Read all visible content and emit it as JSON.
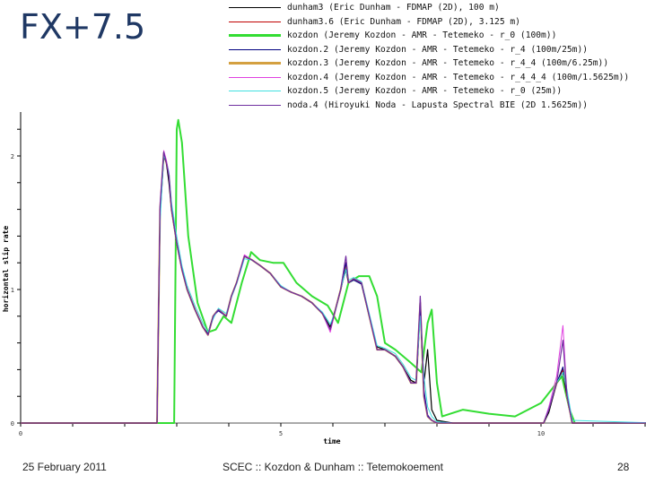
{
  "slide": {
    "title": "FX+7.5",
    "footer_date": "25 February 2011",
    "footer_center": "SCEC :: Kozdon & Dunham :: Tetemokoement",
    "page_number": "28"
  },
  "chart_data": {
    "type": "line",
    "title": "",
    "xlabel": "time",
    "ylabel": "horizontal slip rate",
    "xlim": [
      0,
      12.2
    ],
    "ylim": [
      0,
      2.33
    ],
    "x_ticks": [
      0,
      1,
      2,
      3,
      4,
      5,
      6,
      7,
      8,
      9,
      10,
      11,
      12
    ],
    "x_tick_labels": [
      {
        "value": 0,
        "label": "0"
      },
      {
        "value": 5,
        "label": "5"
      },
      {
        "value": 10,
        "label": "10"
      }
    ],
    "y_ticks": [
      0,
      0.2,
      0.4,
      0.6,
      0.8,
      1,
      1.2,
      1.4,
      1.6,
      1.8,
      2,
      2.2
    ],
    "y_tick_labels": [
      {
        "value": 0,
        "label": "0"
      },
      {
        "value": 1,
        "label": "1"
      },
      {
        "value": 2,
        "label": "2"
      }
    ],
    "grid": false,
    "legend_position": "top",
    "common_x": [
      0,
      2.62,
      2.68,
      2.75,
      2.8,
      2.85,
      2.9,
      3.0,
      3.1,
      3.2,
      3.35,
      3.5,
      3.6,
      3.7,
      3.8,
      3.95,
      4.05,
      4.15,
      4.3,
      4.45,
      4.6,
      4.8,
      5.0,
      5.2,
      5.4,
      5.6,
      5.8,
      5.95,
      6.05,
      6.15,
      6.25,
      6.3,
      6.4,
      6.55,
      6.7,
      6.85,
      7.0,
      7.2,
      7.35,
      7.5,
      7.6,
      7.68,
      7.75,
      7.82,
      7.9,
      8.0,
      8.3,
      10.05,
      10.15,
      10.3,
      10.42,
      10.5,
      10.6,
      12.2
    ],
    "series": [
      {
        "name": "dunham3 (Eric Dunham - FDMAP (2D), 100 m)",
        "color": "#000000",
        "width": 1.2,
        "y": [
          0,
          0,
          1.55,
          2.0,
          1.95,
          1.8,
          1.6,
          1.35,
          1.15,
          1.0,
          0.85,
          0.72,
          0.67,
          0.8,
          0.85,
          0.8,
          0.95,
          1.05,
          1.25,
          1.22,
          1.18,
          1.12,
          1.02,
          0.98,
          0.95,
          0.9,
          0.82,
          0.72,
          0.85,
          1.0,
          1.15,
          1.05,
          1.08,
          1.05,
          0.8,
          0.57,
          0.55,
          0.5,
          0.42,
          0.32,
          0.3,
          0.85,
          0.3,
          0.55,
          0.1,
          0.02,
          0,
          0,
          0.08,
          0.3,
          0.38,
          0.2,
          0,
          0
        ]
      },
      {
        "name": "dunham3.6 (Eric Dunham - FDMAP (2D), 3.125 m)",
        "color": "#c00000",
        "width": 1,
        "y": [
          0,
          0,
          1.6,
          2.02,
          1.95,
          1.85,
          1.6,
          1.35,
          1.15,
          1.0,
          0.85,
          0.72,
          0.66,
          0.8,
          0.85,
          0.8,
          0.95,
          1.05,
          1.25,
          1.22,
          1.18,
          1.12,
          1.02,
          0.98,
          0.95,
          0.9,
          0.82,
          0.7,
          0.85,
          1.0,
          1.2,
          1.05,
          1.08,
          1.05,
          0.8,
          0.55,
          0.55,
          0.5,
          0.42,
          0.3,
          0.3,
          0.9,
          0.2,
          0.05,
          0.02,
          0,
          0,
          0,
          0.1,
          0.3,
          0.4,
          0.2,
          0,
          0
        ]
      },
      {
        "name": "kozdon (Jeremy Kozdon - AMR - Tetemeko - r_0 (100m))",
        "color": "#33dd33",
        "width": 2,
        "x": [
          0,
          2.95,
          3.0,
          3.03,
          3.1,
          3.22,
          3.4,
          3.6,
          3.75,
          3.9,
          4.05,
          4.25,
          4.43,
          4.6,
          4.85,
          5.05,
          5.3,
          5.6,
          5.9,
          6.1,
          6.3,
          6.5,
          6.7,
          6.85,
          7.0,
          7.2,
          7.5,
          7.7,
          7.82,
          7.9,
          8.0,
          8.1,
          8.5,
          9.0,
          9.5,
          10.0,
          10.4,
          10.55,
          10.65,
          12.2
        ],
        "y": [
          0,
          0,
          2.2,
          2.27,
          2.1,
          1.4,
          0.9,
          0.68,
          0.7,
          0.8,
          0.75,
          1.05,
          1.28,
          1.22,
          1.2,
          1.2,
          1.05,
          0.95,
          0.88,
          0.75,
          1.05,
          1.1,
          1.1,
          0.95,
          0.6,
          0.55,
          0.45,
          0.38,
          0.75,
          0.85,
          0.3,
          0.05,
          0.1,
          0.07,
          0.05,
          0.15,
          0.35,
          0.1,
          0,
          0
        ]
      },
      {
        "name": "kozdon.2 (Jeremy Kozdon - AMR - Tetemeko - r_4 (100m/25m))",
        "color": "#000080",
        "width": 1,
        "y": [
          0,
          0,
          1.62,
          2.03,
          1.96,
          1.84,
          1.6,
          1.34,
          1.15,
          1.0,
          0.85,
          0.72,
          0.66,
          0.8,
          0.84,
          0.8,
          0.95,
          1.05,
          1.25,
          1.22,
          1.18,
          1.12,
          1.02,
          0.98,
          0.95,
          0.9,
          0.82,
          0.7,
          0.85,
          1.0,
          1.2,
          1.05,
          1.07,
          1.04,
          0.8,
          0.55,
          0.55,
          0.5,
          0.42,
          0.3,
          0.3,
          0.85,
          0.25,
          0.06,
          0.02,
          0,
          0,
          0,
          0.1,
          0.3,
          0.42,
          0.2,
          0,
          0
        ]
      },
      {
        "name": "kozdon.3 (Jeremy Kozdon - AMR - Tetemeko - r_4_4 (100m/6.25m))",
        "color": "#d4a040",
        "width": 2,
        "y": [
          0,
          0,
          1.6,
          2.02,
          1.95,
          1.85,
          1.6,
          1.35,
          1.15,
          1.0,
          0.85,
          0.72,
          0.66,
          0.8,
          0.85,
          0.8,
          0.95,
          1.05,
          1.25,
          1.22,
          1.18,
          1.12,
          1.02,
          0.98,
          0.95,
          0.9,
          0.82,
          0.7,
          0.85,
          1.0,
          1.2,
          1.05,
          1.08,
          1.05,
          0.8,
          0.55,
          0.55,
          0.5,
          0.42,
          0.3,
          0.3,
          0.9,
          0.2,
          0.05,
          0.02,
          0,
          0,
          0,
          0.1,
          0.3,
          0.4,
          0.2,
          0,
          0
        ]
      },
      {
        "name": "kozdon.4 (Jeremy Kozdon - AMR - Tetemeko - r_4_4_4 (100m/1.5625m))",
        "color": "#e040e0",
        "width": 1,
        "y": [
          0,
          0,
          1.65,
          2.04,
          1.97,
          1.86,
          1.6,
          1.35,
          1.15,
          1.0,
          0.85,
          0.72,
          0.66,
          0.8,
          0.85,
          0.8,
          0.95,
          1.05,
          1.26,
          1.22,
          1.18,
          1.12,
          1.02,
          0.98,
          0.95,
          0.9,
          0.82,
          0.68,
          0.85,
          1.0,
          1.25,
          1.05,
          1.08,
          1.05,
          0.8,
          0.55,
          0.55,
          0.5,
          0.42,
          0.3,
          0.3,
          0.95,
          0.2,
          0.05,
          0.02,
          0,
          0,
          0,
          0.12,
          0.35,
          0.73,
          0.2,
          0,
          0
        ]
      },
      {
        "name": "kozdon.5 (Jeremy Kozdon - AMR - Tetemeko - r_0 (25m))",
        "color": "#40e0e0",
        "width": 1,
        "y": [
          0,
          0,
          1.5,
          2.0,
          1.96,
          1.88,
          1.65,
          1.4,
          1.18,
          1.03,
          0.88,
          0.75,
          0.68,
          0.78,
          0.86,
          0.82,
          0.94,
          1.04,
          1.23,
          1.22,
          1.18,
          1.12,
          1.03,
          0.98,
          0.95,
          0.9,
          0.83,
          0.74,
          0.84,
          1.0,
          1.15,
          1.07,
          1.09,
          1.06,
          0.82,
          0.58,
          0.56,
          0.52,
          0.44,
          0.34,
          0.32,
          0.8,
          0.35,
          0.12,
          0.05,
          0.01,
          0,
          0,
          0.12,
          0.3,
          0.38,
          0.25,
          0.02,
          0
        ]
      },
      {
        "name": "noda.4 (Hiroyuki Noda - Lapusta Spectral BIE (2D 1.5625m))",
        "color": "#7030a0",
        "width": 1.2,
        "y": [
          0,
          0,
          1.62,
          2.03,
          1.95,
          1.85,
          1.6,
          1.35,
          1.15,
          1.0,
          0.85,
          0.72,
          0.66,
          0.8,
          0.85,
          0.8,
          0.95,
          1.05,
          1.25,
          1.22,
          1.18,
          1.12,
          1.02,
          0.98,
          0.95,
          0.9,
          0.82,
          0.7,
          0.85,
          1.0,
          1.25,
          1.05,
          1.08,
          1.05,
          0.8,
          0.55,
          0.55,
          0.5,
          0.42,
          0.3,
          0.3,
          0.95,
          0.2,
          0.05,
          0.02,
          0,
          0,
          0,
          0.1,
          0.3,
          0.62,
          0.2,
          0,
          0
        ]
      }
    ]
  }
}
